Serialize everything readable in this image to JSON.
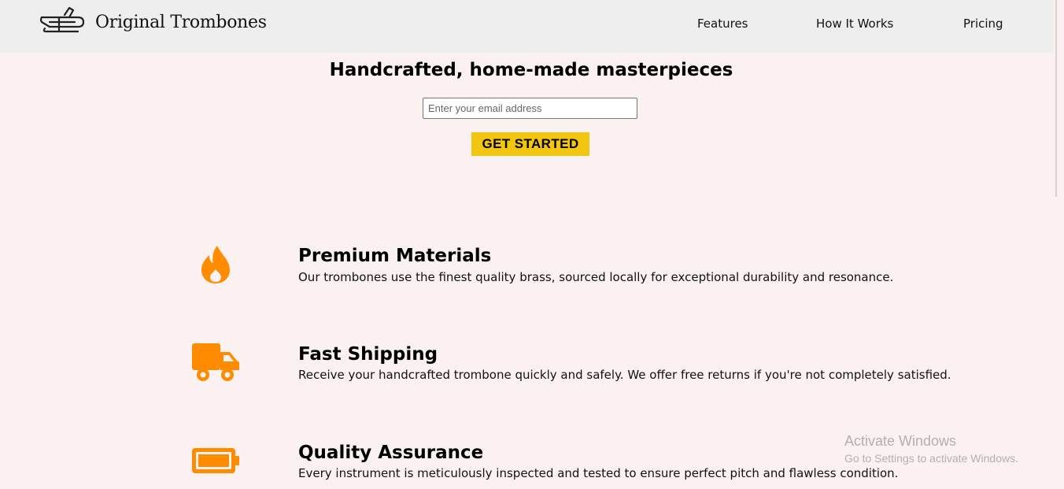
{
  "header": {
    "brand": "Original Trombones",
    "logo_icon": "trombone-icon",
    "nav": {
      "features": "Features",
      "how_it_works": "How It Works",
      "pricing": "Pricing"
    }
  },
  "hero": {
    "title": "Handcrafted, home-made masterpieces",
    "email_placeholder": "Enter your email address",
    "cta_label": "GET STARTED"
  },
  "features": [
    {
      "icon": "fire-icon",
      "title": "Premium Materials",
      "description": "Our trombones use the finest quality brass, sourced locally for exceptional durability and resonance."
    },
    {
      "icon": "truck-icon",
      "title": "Fast Shipping",
      "description": "Receive your handcrafted trombone quickly and safely. We offer free returns if you're not completely satisfied."
    },
    {
      "icon": "battery-icon",
      "title": "Quality Assurance",
      "description": "Every instrument is meticulously inspected and tested to ensure perfect pitch and flawless condition."
    }
  ],
  "watermark": {
    "title": "Activate Windows",
    "subtitle": "Go to Settings to activate Windows."
  },
  "colors": {
    "background": "#fbf1f0",
    "header": "#eeeeee",
    "cta": "#f2c511",
    "icon_accent": "#ff8c00"
  }
}
